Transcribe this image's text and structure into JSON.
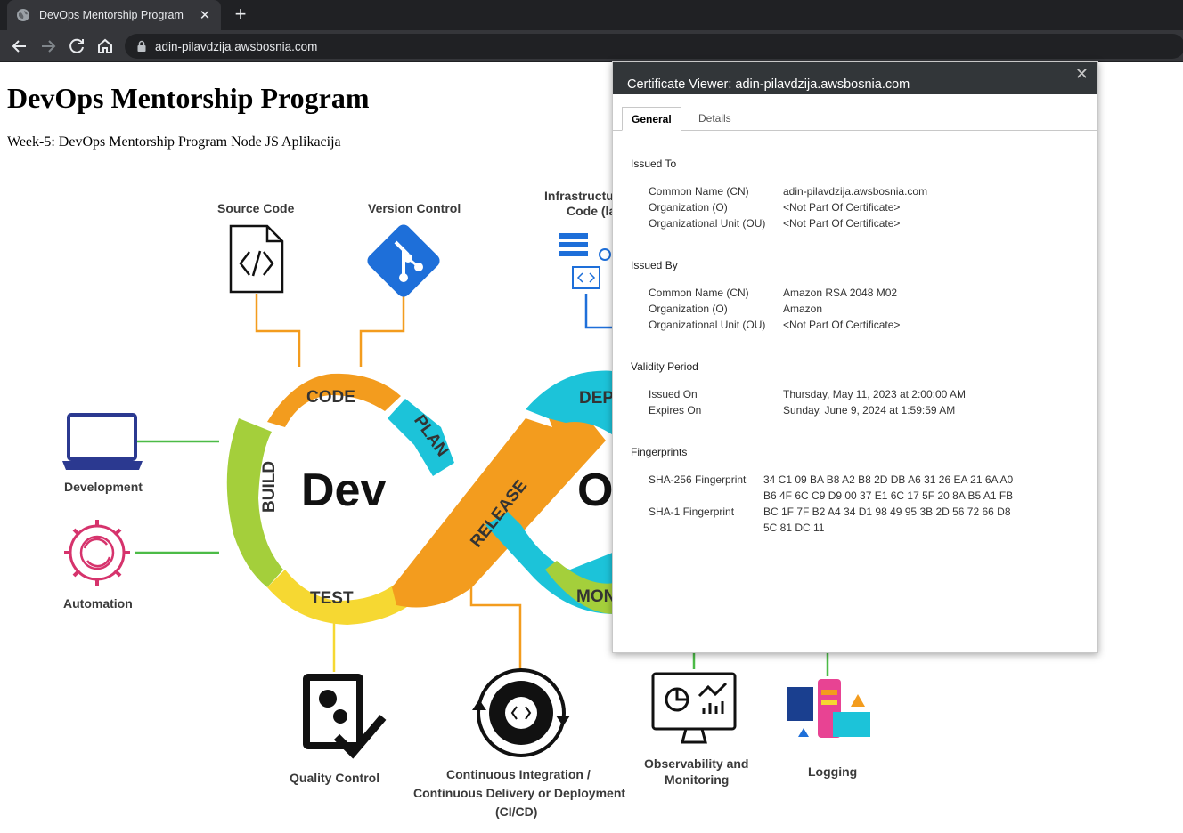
{
  "browser": {
    "tab_title": "DevOps Mentorship Program",
    "tab_close": "✕",
    "new_tab": "+",
    "url": "adin-pilavdzija.awsbosnia.com"
  },
  "page": {
    "heading": "DevOps Mentorship Program",
    "subheading": "Week-5: DevOps Mentorship Program Node JS Aplikacija"
  },
  "diagram": {
    "center_dev": "Dev",
    "center_ops": "O",
    "segments": {
      "code": "CODE",
      "plan": "PLAN",
      "build": "BUILD",
      "test": "TEST",
      "release": "RELEASE",
      "deploy": "DEP",
      "monitor": "MON"
    },
    "labels": {
      "source_code": "Source Code",
      "version_control": "Version Control",
      "iac_line1": "Infrastructur",
      "iac_line2": "Code (la",
      "development": "Development",
      "automation": "Automation",
      "quality_control": "Quality Control",
      "cicd_line1": "Continuous Integration /",
      "cicd_line2": "Continuous Delivery or Deployment",
      "cicd_line3": "(CI/CD)",
      "observability_line1": "Observability and",
      "observability_line2": "Monitoring",
      "logging": "Logging"
    },
    "colors": {
      "orange": "#f39c1e",
      "yellow": "#f6d832",
      "green": "#a4cf3b",
      "cyan": "#1cc3d9",
      "blue_git": "#1e6fd9",
      "magenta": "#d6336c",
      "navy": "#2b3990"
    }
  },
  "certificate": {
    "title": "Certificate Viewer: adin-pilavdzija.awsbosnia.com",
    "close": "✕",
    "tabs": {
      "general": "General",
      "details": "Details"
    },
    "issued_to": {
      "title": "Issued To",
      "cn_label": "Common Name (CN)",
      "cn_value": "adin-pilavdzija.awsbosnia.com",
      "o_label": "Organization (O)",
      "o_value": "<Not Part Of Certificate>",
      "ou_label": "Organizational Unit (OU)",
      "ou_value": "<Not Part Of Certificate>"
    },
    "issued_by": {
      "title": "Issued By",
      "cn_label": "Common Name (CN)",
      "cn_value": "Amazon RSA 2048 M02",
      "o_label": "Organization (O)",
      "o_value": "Amazon",
      "ou_label": "Organizational Unit (OU)",
      "ou_value": "<Not Part Of Certificate>"
    },
    "validity": {
      "title": "Validity Period",
      "issued_label": "Issued On",
      "issued_value": "Thursday, May 11, 2023 at 2:00:00 AM",
      "expires_label": "Expires On",
      "expires_value": "Sunday, June 9, 2024 at 1:59:59 AM"
    },
    "fingerprints": {
      "title": "Fingerprints",
      "sha256_label": "SHA-256 Fingerprint",
      "sha256_line1": "34 C1 09 BA B8 A2 B8 2D DB A6 31 26 EA 21 6A A0",
      "sha256_line2": "B6 4F 6C C9 D9 00 37 E1 6C 17 5F 20 8A B5 A1 FB",
      "sha1_label": "SHA-1 Fingerprint",
      "sha1_line1": "BC 1F 7F B2 A4 34 D1 98 49 95 3B 2D 56 72 66 D8",
      "sha1_line2": "5C 81 DC 11"
    }
  }
}
